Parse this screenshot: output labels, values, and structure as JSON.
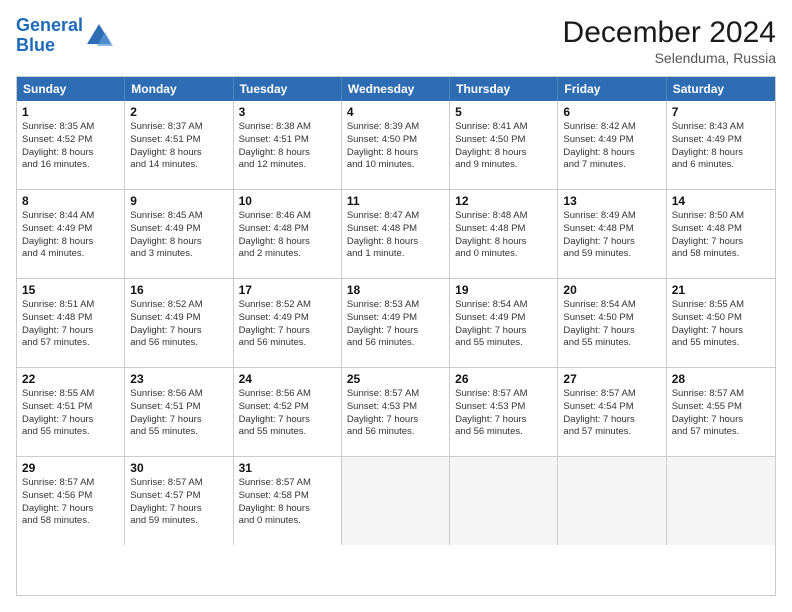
{
  "header": {
    "logo_line1": "General",
    "logo_line2": "Blue",
    "month": "December 2024",
    "location": "Selenduma, Russia"
  },
  "days_of_week": [
    "Sunday",
    "Monday",
    "Tuesday",
    "Wednesday",
    "Thursday",
    "Friday",
    "Saturday"
  ],
  "weeks": [
    [
      {
        "day": "1",
        "lines": [
          "Sunrise: 8:35 AM",
          "Sunset: 4:52 PM",
          "Daylight: 8 hours",
          "and 16 minutes."
        ]
      },
      {
        "day": "2",
        "lines": [
          "Sunrise: 8:37 AM",
          "Sunset: 4:51 PM",
          "Daylight: 8 hours",
          "and 14 minutes."
        ]
      },
      {
        "day": "3",
        "lines": [
          "Sunrise: 8:38 AM",
          "Sunset: 4:51 PM",
          "Daylight: 8 hours",
          "and 12 minutes."
        ]
      },
      {
        "day": "4",
        "lines": [
          "Sunrise: 8:39 AM",
          "Sunset: 4:50 PM",
          "Daylight: 8 hours",
          "and 10 minutes."
        ]
      },
      {
        "day": "5",
        "lines": [
          "Sunrise: 8:41 AM",
          "Sunset: 4:50 PM",
          "Daylight: 8 hours",
          "and 9 minutes."
        ]
      },
      {
        "day": "6",
        "lines": [
          "Sunrise: 8:42 AM",
          "Sunset: 4:49 PM",
          "Daylight: 8 hours",
          "and 7 minutes."
        ]
      },
      {
        "day": "7",
        "lines": [
          "Sunrise: 8:43 AM",
          "Sunset: 4:49 PM",
          "Daylight: 8 hours",
          "and 6 minutes."
        ]
      }
    ],
    [
      {
        "day": "8",
        "lines": [
          "Sunrise: 8:44 AM",
          "Sunset: 4:49 PM",
          "Daylight: 8 hours",
          "and 4 minutes."
        ]
      },
      {
        "day": "9",
        "lines": [
          "Sunrise: 8:45 AM",
          "Sunset: 4:49 PM",
          "Daylight: 8 hours",
          "and 3 minutes."
        ]
      },
      {
        "day": "10",
        "lines": [
          "Sunrise: 8:46 AM",
          "Sunset: 4:48 PM",
          "Daylight: 8 hours",
          "and 2 minutes."
        ]
      },
      {
        "day": "11",
        "lines": [
          "Sunrise: 8:47 AM",
          "Sunset: 4:48 PM",
          "Daylight: 8 hours",
          "and 1 minute."
        ]
      },
      {
        "day": "12",
        "lines": [
          "Sunrise: 8:48 AM",
          "Sunset: 4:48 PM",
          "Daylight: 8 hours",
          "and 0 minutes."
        ]
      },
      {
        "day": "13",
        "lines": [
          "Sunrise: 8:49 AM",
          "Sunset: 4:48 PM",
          "Daylight: 7 hours",
          "and 59 minutes."
        ]
      },
      {
        "day": "14",
        "lines": [
          "Sunrise: 8:50 AM",
          "Sunset: 4:48 PM",
          "Daylight: 7 hours",
          "and 58 minutes."
        ]
      }
    ],
    [
      {
        "day": "15",
        "lines": [
          "Sunrise: 8:51 AM",
          "Sunset: 4:48 PM",
          "Daylight: 7 hours",
          "and 57 minutes."
        ]
      },
      {
        "day": "16",
        "lines": [
          "Sunrise: 8:52 AM",
          "Sunset: 4:49 PM",
          "Daylight: 7 hours",
          "and 56 minutes."
        ]
      },
      {
        "day": "17",
        "lines": [
          "Sunrise: 8:52 AM",
          "Sunset: 4:49 PM",
          "Daylight: 7 hours",
          "and 56 minutes."
        ]
      },
      {
        "day": "18",
        "lines": [
          "Sunrise: 8:53 AM",
          "Sunset: 4:49 PM",
          "Daylight: 7 hours",
          "and 56 minutes."
        ]
      },
      {
        "day": "19",
        "lines": [
          "Sunrise: 8:54 AM",
          "Sunset: 4:49 PM",
          "Daylight: 7 hours",
          "and 55 minutes."
        ]
      },
      {
        "day": "20",
        "lines": [
          "Sunrise: 8:54 AM",
          "Sunset: 4:50 PM",
          "Daylight: 7 hours",
          "and 55 minutes."
        ]
      },
      {
        "day": "21",
        "lines": [
          "Sunrise: 8:55 AM",
          "Sunset: 4:50 PM",
          "Daylight: 7 hours",
          "and 55 minutes."
        ]
      }
    ],
    [
      {
        "day": "22",
        "lines": [
          "Sunrise: 8:55 AM",
          "Sunset: 4:51 PM",
          "Daylight: 7 hours",
          "and 55 minutes."
        ]
      },
      {
        "day": "23",
        "lines": [
          "Sunrise: 8:56 AM",
          "Sunset: 4:51 PM",
          "Daylight: 7 hours",
          "and 55 minutes."
        ]
      },
      {
        "day": "24",
        "lines": [
          "Sunrise: 8:56 AM",
          "Sunset: 4:52 PM",
          "Daylight: 7 hours",
          "and 55 minutes."
        ]
      },
      {
        "day": "25",
        "lines": [
          "Sunrise: 8:57 AM",
          "Sunset: 4:53 PM",
          "Daylight: 7 hours",
          "and 56 minutes."
        ]
      },
      {
        "day": "26",
        "lines": [
          "Sunrise: 8:57 AM",
          "Sunset: 4:53 PM",
          "Daylight: 7 hours",
          "and 56 minutes."
        ]
      },
      {
        "day": "27",
        "lines": [
          "Sunrise: 8:57 AM",
          "Sunset: 4:54 PM",
          "Daylight: 7 hours",
          "and 57 minutes."
        ]
      },
      {
        "day": "28",
        "lines": [
          "Sunrise: 8:57 AM",
          "Sunset: 4:55 PM",
          "Daylight: 7 hours",
          "and 57 minutes."
        ]
      }
    ],
    [
      {
        "day": "29",
        "lines": [
          "Sunrise: 8:57 AM",
          "Sunset: 4:56 PM",
          "Daylight: 7 hours",
          "and 58 minutes."
        ]
      },
      {
        "day": "30",
        "lines": [
          "Sunrise: 8:57 AM",
          "Sunset: 4:57 PM",
          "Daylight: 7 hours",
          "and 59 minutes."
        ]
      },
      {
        "day": "31",
        "lines": [
          "Sunrise: 8:57 AM",
          "Sunset: 4:58 PM",
          "Daylight: 8 hours",
          "and 0 minutes."
        ]
      },
      {
        "day": "",
        "lines": []
      },
      {
        "day": "",
        "lines": []
      },
      {
        "day": "",
        "lines": []
      },
      {
        "day": "",
        "lines": []
      }
    ]
  ]
}
